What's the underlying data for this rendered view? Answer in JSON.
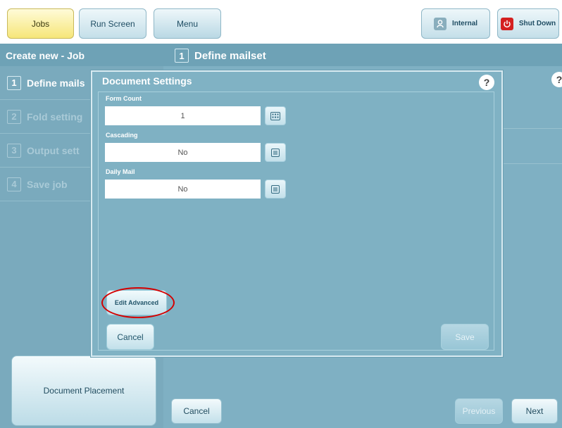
{
  "topbar": {
    "jobs_label": "Jobs",
    "run_screen_label": "Run Screen",
    "menu_label": "Menu",
    "internal_label": "Internal",
    "shutdown_label": "Shut Down",
    "user_icon": "user-icon",
    "power_icon": "power-icon"
  },
  "subheader": {
    "left_title": "Create new - Job",
    "step_number": "1",
    "step_title": "Define mailset"
  },
  "steps": [
    {
      "number": "1",
      "label": "Define mails"
    },
    {
      "number": "2",
      "label": "Fold setting"
    },
    {
      "number": "3",
      "label": "Output sett"
    },
    {
      "number": "4",
      "label": "Save job"
    }
  ],
  "help_glyph": "?",
  "dialog": {
    "title": "Document Settings",
    "fields": [
      {
        "label": "Form Count",
        "value": "1",
        "button_icon": "keypad-icon"
      },
      {
        "label": "Cascading",
        "value": "No",
        "button_icon": "list-icon"
      },
      {
        "label": "Daily Mail",
        "value": "No",
        "button_icon": "list-icon"
      }
    ],
    "edit_advanced_label": "Edit Advanced",
    "cancel_label": "Cancel",
    "save_label": "Save"
  },
  "bottom": {
    "document_placement_label": "Document Placement",
    "cancel_label": "Cancel",
    "previous_label": "Previous",
    "next_label": "Next"
  },
  "colors": {
    "highlight_ring": "#d40000",
    "active_tab": "#f6e679",
    "background": "#7fb0c3"
  }
}
